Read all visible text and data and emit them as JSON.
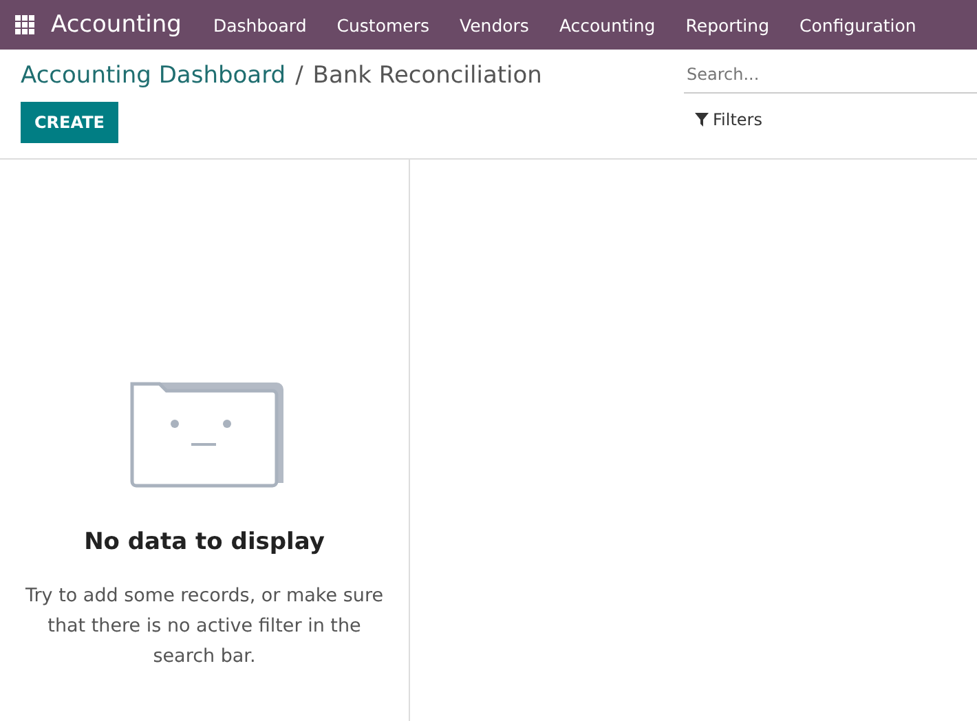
{
  "navbar": {
    "app_name": "Accounting",
    "menu": [
      {
        "label": "Dashboard"
      },
      {
        "label": "Customers"
      },
      {
        "label": "Vendors"
      },
      {
        "label": "Accounting"
      },
      {
        "label": "Reporting"
      },
      {
        "label": "Configuration"
      }
    ]
  },
  "breadcrumb": {
    "parent": "Accounting Dashboard",
    "separator": "/",
    "current": "Bank Reconciliation"
  },
  "create_button": "CREATE",
  "search": {
    "placeholder": "Search..."
  },
  "filters_button": "Filters",
  "empty_state": {
    "title": "No data to display",
    "message": "Try to add some records, or make sure that there is no active filter in the search bar."
  }
}
